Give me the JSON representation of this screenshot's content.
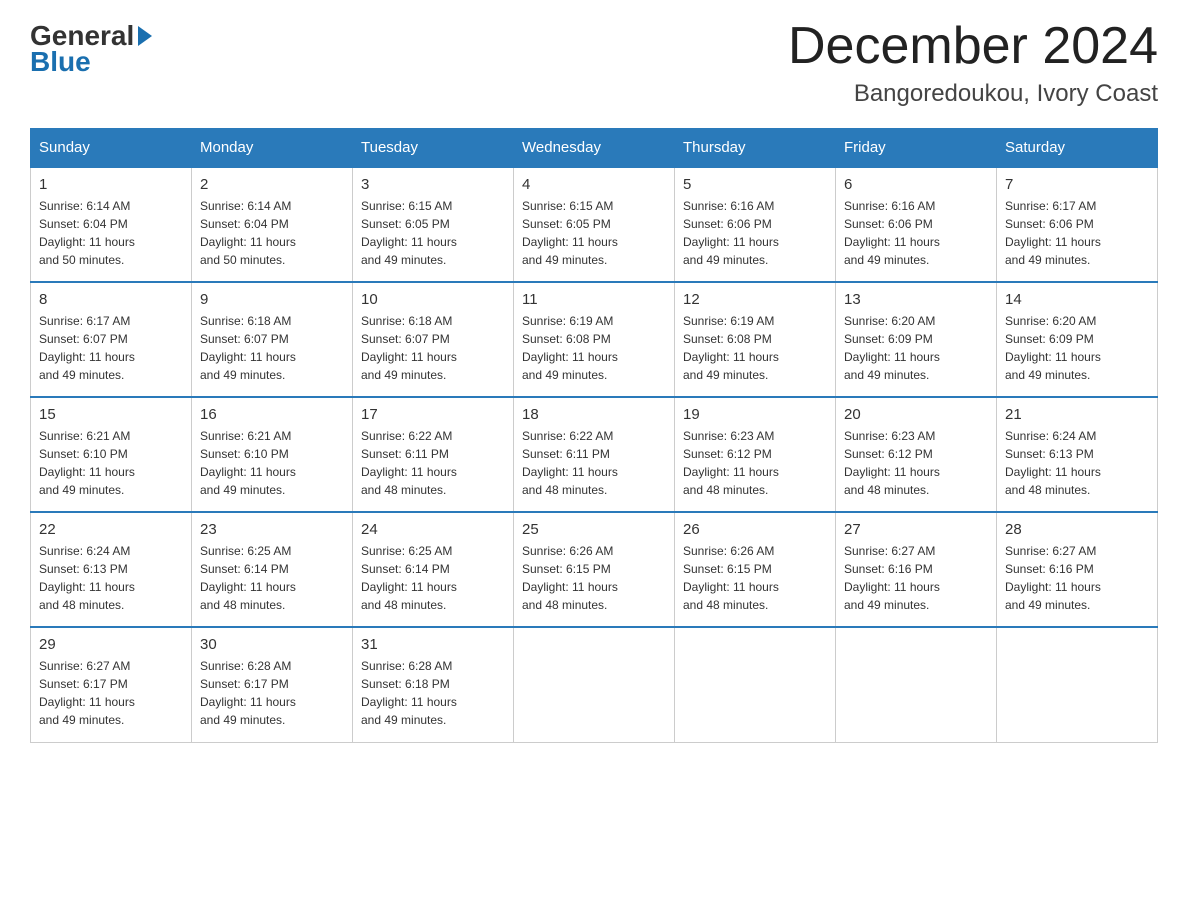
{
  "header": {
    "logo_general": "General",
    "logo_blue": "Blue",
    "month_title": "December 2024",
    "location": "Bangoredoukou, Ivory Coast"
  },
  "days_of_week": [
    "Sunday",
    "Monday",
    "Tuesday",
    "Wednesday",
    "Thursday",
    "Friday",
    "Saturday"
  ],
  "weeks": [
    [
      {
        "day": "1",
        "sunrise": "6:14 AM",
        "sunset": "6:04 PM",
        "daylight": "11 hours and 50 minutes."
      },
      {
        "day": "2",
        "sunrise": "6:14 AM",
        "sunset": "6:04 PM",
        "daylight": "11 hours and 50 minutes."
      },
      {
        "day": "3",
        "sunrise": "6:15 AM",
        "sunset": "6:05 PM",
        "daylight": "11 hours and 49 minutes."
      },
      {
        "day": "4",
        "sunrise": "6:15 AM",
        "sunset": "6:05 PM",
        "daylight": "11 hours and 49 minutes."
      },
      {
        "day": "5",
        "sunrise": "6:16 AM",
        "sunset": "6:06 PM",
        "daylight": "11 hours and 49 minutes."
      },
      {
        "day": "6",
        "sunrise": "6:16 AM",
        "sunset": "6:06 PM",
        "daylight": "11 hours and 49 minutes."
      },
      {
        "day": "7",
        "sunrise": "6:17 AM",
        "sunset": "6:06 PM",
        "daylight": "11 hours and 49 minutes."
      }
    ],
    [
      {
        "day": "8",
        "sunrise": "6:17 AM",
        "sunset": "6:07 PM",
        "daylight": "11 hours and 49 minutes."
      },
      {
        "day": "9",
        "sunrise": "6:18 AM",
        "sunset": "6:07 PM",
        "daylight": "11 hours and 49 minutes."
      },
      {
        "day": "10",
        "sunrise": "6:18 AM",
        "sunset": "6:07 PM",
        "daylight": "11 hours and 49 minutes."
      },
      {
        "day": "11",
        "sunrise": "6:19 AM",
        "sunset": "6:08 PM",
        "daylight": "11 hours and 49 minutes."
      },
      {
        "day": "12",
        "sunrise": "6:19 AM",
        "sunset": "6:08 PM",
        "daylight": "11 hours and 49 minutes."
      },
      {
        "day": "13",
        "sunrise": "6:20 AM",
        "sunset": "6:09 PM",
        "daylight": "11 hours and 49 minutes."
      },
      {
        "day": "14",
        "sunrise": "6:20 AM",
        "sunset": "6:09 PM",
        "daylight": "11 hours and 49 minutes."
      }
    ],
    [
      {
        "day": "15",
        "sunrise": "6:21 AM",
        "sunset": "6:10 PM",
        "daylight": "11 hours and 49 minutes."
      },
      {
        "day": "16",
        "sunrise": "6:21 AM",
        "sunset": "6:10 PM",
        "daylight": "11 hours and 49 minutes."
      },
      {
        "day": "17",
        "sunrise": "6:22 AM",
        "sunset": "6:11 PM",
        "daylight": "11 hours and 48 minutes."
      },
      {
        "day": "18",
        "sunrise": "6:22 AM",
        "sunset": "6:11 PM",
        "daylight": "11 hours and 48 minutes."
      },
      {
        "day": "19",
        "sunrise": "6:23 AM",
        "sunset": "6:12 PM",
        "daylight": "11 hours and 48 minutes."
      },
      {
        "day": "20",
        "sunrise": "6:23 AM",
        "sunset": "6:12 PM",
        "daylight": "11 hours and 48 minutes."
      },
      {
        "day": "21",
        "sunrise": "6:24 AM",
        "sunset": "6:13 PM",
        "daylight": "11 hours and 48 minutes."
      }
    ],
    [
      {
        "day": "22",
        "sunrise": "6:24 AM",
        "sunset": "6:13 PM",
        "daylight": "11 hours and 48 minutes."
      },
      {
        "day": "23",
        "sunrise": "6:25 AM",
        "sunset": "6:14 PM",
        "daylight": "11 hours and 48 minutes."
      },
      {
        "day": "24",
        "sunrise": "6:25 AM",
        "sunset": "6:14 PM",
        "daylight": "11 hours and 48 minutes."
      },
      {
        "day": "25",
        "sunrise": "6:26 AM",
        "sunset": "6:15 PM",
        "daylight": "11 hours and 48 minutes."
      },
      {
        "day": "26",
        "sunrise": "6:26 AM",
        "sunset": "6:15 PM",
        "daylight": "11 hours and 48 minutes."
      },
      {
        "day": "27",
        "sunrise": "6:27 AM",
        "sunset": "6:16 PM",
        "daylight": "11 hours and 49 minutes."
      },
      {
        "day": "28",
        "sunrise": "6:27 AM",
        "sunset": "6:16 PM",
        "daylight": "11 hours and 49 minutes."
      }
    ],
    [
      {
        "day": "29",
        "sunrise": "6:27 AM",
        "sunset": "6:17 PM",
        "daylight": "11 hours and 49 minutes."
      },
      {
        "day": "30",
        "sunrise": "6:28 AM",
        "sunset": "6:17 PM",
        "daylight": "11 hours and 49 minutes."
      },
      {
        "day": "31",
        "sunrise": "6:28 AM",
        "sunset": "6:18 PM",
        "daylight": "11 hours and 49 minutes."
      },
      null,
      null,
      null,
      null
    ]
  ],
  "labels": {
    "sunrise": "Sunrise:",
    "sunset": "Sunset:",
    "daylight": "Daylight:"
  }
}
